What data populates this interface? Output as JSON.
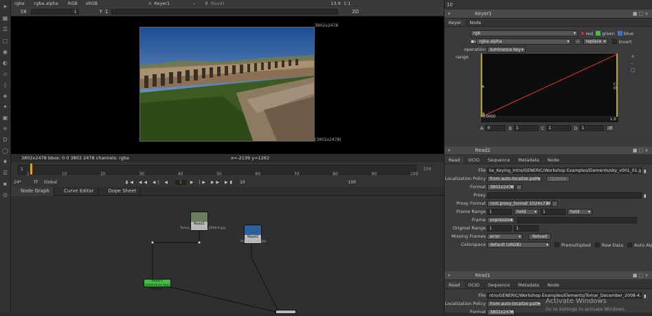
{
  "viewer_toolbar": {
    "channels": "rgba",
    "channel_alpha": "rgba.alpha",
    "colorspace_rgb": "RGB",
    "lut": "sRGB",
    "input_a_label": "A",
    "input_a": "Keyer1",
    "input_b_label": "B",
    "input_b": "Read1",
    "zoom": "13.9",
    "aspect": "1:1",
    "fstop": "f/8",
    "frame": "1",
    "y_label": "Y",
    "y_value": "1",
    "view_mode": "2D"
  },
  "viewer": {
    "format_label_top": "3802x2478",
    "format_label_bottom": "(3802x2478)"
  },
  "infobar": {
    "info": "3802x2478  bbox: 0 0 3802 2478 channels: rgba",
    "coords": "x=-2139 y=1262"
  },
  "timeline": {
    "ticks": [
      "1",
      "10",
      "20",
      "30",
      "40",
      "50",
      "60",
      "70",
      "80",
      "90",
      "100"
    ],
    "in_point": "1",
    "out_point": "100",
    "fps": "24*",
    "tf": "TF",
    "scope": "Global",
    "current_frame": "1",
    "step": "10",
    "end_frame": "100"
  },
  "panel_tabs": [
    "Node Graph",
    "Curve Editor",
    "Dope Sheet"
  ],
  "nodes": {
    "read1_label": "Read1",
    "read1_sub": "Tomar_December_2008-4.jpg",
    "read2_label": "Read2",
    "read2_sub": "sky_v001_01.jpg",
    "keyer_label": "Keyer1 (luminance key)",
    "keyer_sub": "(alpha)"
  },
  "keyer": {
    "panel_number": "10",
    "title": "Keyer1",
    "tabs": [
      "Keyer",
      "Node"
    ],
    "input_label": "input",
    "input_value": "rgb",
    "red": "red",
    "green": "green",
    "blue": "blue",
    "output_label": "output",
    "output_value": "rgba.alpha",
    "replace": "replace",
    "invert": "invert",
    "operation_label": "operation",
    "operation_value": "luminance key",
    "range_label": "range",
    "curve_a": "A",
    "curve_b": "B",
    "curve_c": "C",
    "curve_d": "D",
    "curve_value_left": "0.0000",
    "curve_value_right": "1.0",
    "a_label": "A",
    "a_value": "0",
    "b_label": "B",
    "b_value": "1",
    "c_label": "C",
    "c_value": "1",
    "d_label": "D",
    "d_value": "1"
  },
  "read2": {
    "title": "Read2",
    "tabs": [
      "Read",
      "OCIO",
      "Sequence",
      "Metadata",
      "Node"
    ],
    "file_label": "File",
    "file_value": "ke_Keying_Intro/GENERIC/Workshop Examples/Elements/sky_v001_01.jpg",
    "locpolicy_label": "Localization Policy",
    "locpolicy_value": "from auto-localize path",
    "update_btn": "Update",
    "format_label": "Format",
    "format_value": "3802x2478",
    "proxy_label": "Proxy",
    "proxy_format_label": "Proxy Format",
    "proxy_format_value": "root.proxy_format 1024x778",
    "frame_range_label": "Frame Range",
    "frame_range_start": "1",
    "frame_range_start_mode": "hold",
    "frame_range_end": "1",
    "frame_range_end_mode": "hold",
    "frame_label": "Frame",
    "frame_value": "expression",
    "original_range_label": "Original Range",
    "original_range_start": "1",
    "original_range_end": "1",
    "missing_frames_label": "Missing Frames",
    "missing_frames_value": "error",
    "reload_btn": "Reload",
    "colorspace_label": "Colorspace",
    "colorspace_value": "default (sRGB)",
    "premultiplied": "Premultiplied",
    "raw_data": "Raw Data",
    "auto_alpha": "Auto Alpha"
  },
  "read1": {
    "title": "Read1",
    "tabs": [
      "Read",
      "OCIO",
      "Sequence",
      "Metadata",
      "Node"
    ],
    "file_label": "File",
    "file_value": "ntro/GENERIC/Workshop Examples/Elements/Tomar_December_2008-4.jpg",
    "locpolicy_label": "Localization Policy",
    "locpolicy_value": "from auto-localize path",
    "format_label": "Format",
    "format_value": "3802x2478"
  },
  "watermark": {
    "line1": "Activate Windows",
    "line2": "Go to Settings to activate Windows."
  },
  "colors": {
    "keyer_node": "#3fbf3f",
    "curve_red": "#e23a2a",
    "curve_yellow": "#e8d21c",
    "background": "#2b2b2b"
  }
}
